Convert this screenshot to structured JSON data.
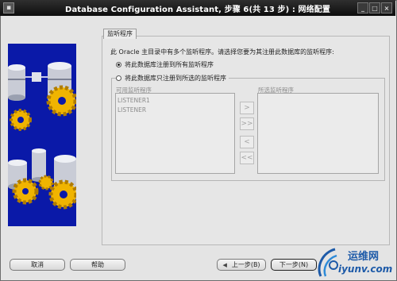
{
  "window": {
    "title": "Database Configuration Assistant, 步骤 6(共 13 步) : 网络配置"
  },
  "tab": {
    "label": "监听程序"
  },
  "instruction": "此 Oracle 主目录中有多个监听程序。请选择您要为其注册此数据库的监听程序:",
  "options": [
    {
      "label": "将此数据库注册到所有监听程序",
      "checked": true
    },
    {
      "label": "将此数据库只注册到所选的监听程序",
      "checked": false
    }
  ],
  "available": {
    "label": "可用监听程序",
    "items": [
      "LISTENER1",
      "LISTENER"
    ]
  },
  "selected": {
    "label": "所选监听程序",
    "items": []
  },
  "move_buttons": {
    "add": ">",
    "add_all": ">>",
    "remove": "<",
    "remove_all": "<<"
  },
  "buttons": {
    "cancel": "取消",
    "help": "帮助",
    "back": "上一步(B)",
    "next": "下一步(N)"
  },
  "watermark": {
    "text_cn": "运维网",
    "text_url": "iyunv.com"
  },
  "colors": {
    "titlebar": "#111111",
    "banner": "#0a19a8",
    "gear": "#f0b400",
    "watermark": "#1d5aa8"
  }
}
